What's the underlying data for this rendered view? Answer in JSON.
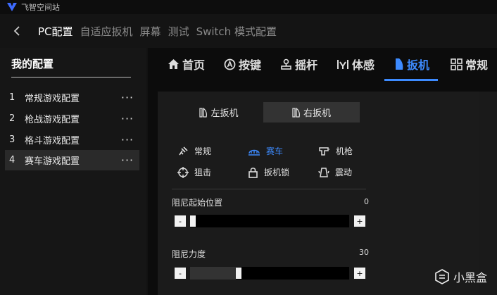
{
  "app": {
    "title": "飞智空间站"
  },
  "nav": {
    "items": [
      {
        "label": "PC配置",
        "active": true
      },
      {
        "label": "自适应扳机",
        "active": false
      },
      {
        "label": "屏幕",
        "active": false
      },
      {
        "label": "测试",
        "active": false
      },
      {
        "label": "Switch 模式配置",
        "active": false
      }
    ]
  },
  "sidebar": {
    "title": "我的配置",
    "configs": [
      {
        "num": "1",
        "name": "常规游戏配置",
        "more": "···"
      },
      {
        "num": "2",
        "name": "枪战游戏配置",
        "more": "···"
      },
      {
        "num": "3",
        "name": "格斗游戏配置",
        "more": "···"
      },
      {
        "num": "4",
        "name": "赛车游戏配置",
        "more": "···",
        "selected": true
      }
    ]
  },
  "tabs": [
    {
      "label": "首页",
      "icon": "home-icon"
    },
    {
      "label": "按键",
      "icon": "button-a-icon"
    },
    {
      "label": "摇杆",
      "icon": "joystick-icon"
    },
    {
      "label": "体感",
      "icon": "motion-icon"
    },
    {
      "label": "扳机",
      "icon": "trigger-icon",
      "active": true
    },
    {
      "label": "常规",
      "icon": "grid-icon"
    }
  ],
  "trigger": {
    "left_label": "左扳机",
    "right_label": "右扳机",
    "active_side": "right",
    "modes": [
      {
        "label": "常规",
        "icon": "normal-icon"
      },
      {
        "label": "赛车",
        "icon": "racing-icon",
        "active": true
      },
      {
        "label": "机枪",
        "icon": "machine-gun-icon"
      },
      {
        "label": "狙击",
        "icon": "crosshair-icon"
      },
      {
        "label": "扳机锁",
        "icon": "lock-icon"
      },
      {
        "label": "震动",
        "icon": "vibration-icon"
      }
    ],
    "sliders": [
      {
        "label": "阻尼起始位置",
        "value": "0",
        "minus": "-",
        "plus": "+",
        "level": 0
      },
      {
        "label": "阻尼力度",
        "value": "30",
        "minus": "-",
        "plus": "+",
        "level": 30
      }
    ]
  },
  "watermark": {
    "text": "小黑盒"
  },
  "colors": {
    "accent": "#3d8bff",
    "background": "#121212"
  }
}
